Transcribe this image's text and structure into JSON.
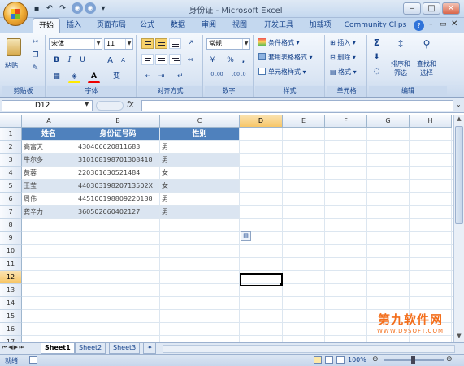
{
  "window": {
    "title": "身份证 - Microsoft Excel"
  },
  "quick_access": [
    "save-icon",
    "undo-icon",
    "redo-icon",
    "new-icon",
    "open-icon"
  ],
  "tabs": [
    "开始",
    "插入",
    "页面布局",
    "公式",
    "数据",
    "审阅",
    "视图",
    "开发工具",
    "加载项",
    "Community Clips"
  ],
  "ribbon": {
    "clipboard": {
      "paste": "粘贴",
      "label": "剪贴板"
    },
    "font": {
      "name": "宋体",
      "size": "11",
      "label": "字体",
      "bold": "B",
      "italic": "I",
      "underline": "U",
      "grow": "A",
      "shrink": "A",
      "fontcolor": "A",
      "phonetic": "变"
    },
    "align": {
      "label": "对齐方式"
    },
    "number": {
      "format": "常规",
      "pct": "%",
      "comma": ",",
      "label": "数字",
      "inc": ".0 .00",
      "dec": ".00 .0"
    },
    "styles": {
      "cond": "条件格式",
      "table": "套用表格格式",
      "cell": "单元格样式",
      "label": "样式"
    },
    "cells": {
      "insert": "插入",
      "delete": "删除",
      "format": "格式",
      "label": "单元格"
    },
    "editing": {
      "sigma": "Σ",
      "sort": "排序和\n筛选",
      "find": "查找和\n选择",
      "label": "编辑"
    }
  },
  "formula": {
    "namebox": "D12",
    "fx": "fx",
    "value": ""
  },
  "columns": [
    "A",
    "B",
    "C",
    "D",
    "E",
    "F",
    "G",
    "H"
  ],
  "rows": [
    "1",
    "2",
    "3",
    "4",
    "5",
    "6",
    "7",
    "8",
    "9",
    "10",
    "11",
    "12",
    "13",
    "14",
    "15",
    "16",
    "17"
  ],
  "table": {
    "headers": [
      "姓名",
      "身份证号码",
      "性别"
    ],
    "rows": [
      [
        "高富天",
        "430406620811683",
        "男"
      ],
      [
        "牛尔多",
        "310108198701308418",
        "男"
      ],
      [
        "黄蓉",
        "220301630521484",
        "女"
      ],
      [
        "王莹",
        "44030319820713502X",
        "女"
      ],
      [
        "周伟",
        "445100198809220138",
        "男"
      ],
      [
        "龚辛力",
        "360502660402127",
        "男"
      ]
    ]
  },
  "sheets": [
    "Sheet1",
    "Sheet2",
    "Sheet3"
  ],
  "status": {
    "mode": "就绪",
    "zoom": "100%"
  },
  "watermark": {
    "line1": "第九软件网",
    "line2": "WWW.D9SOFT.COM"
  }
}
